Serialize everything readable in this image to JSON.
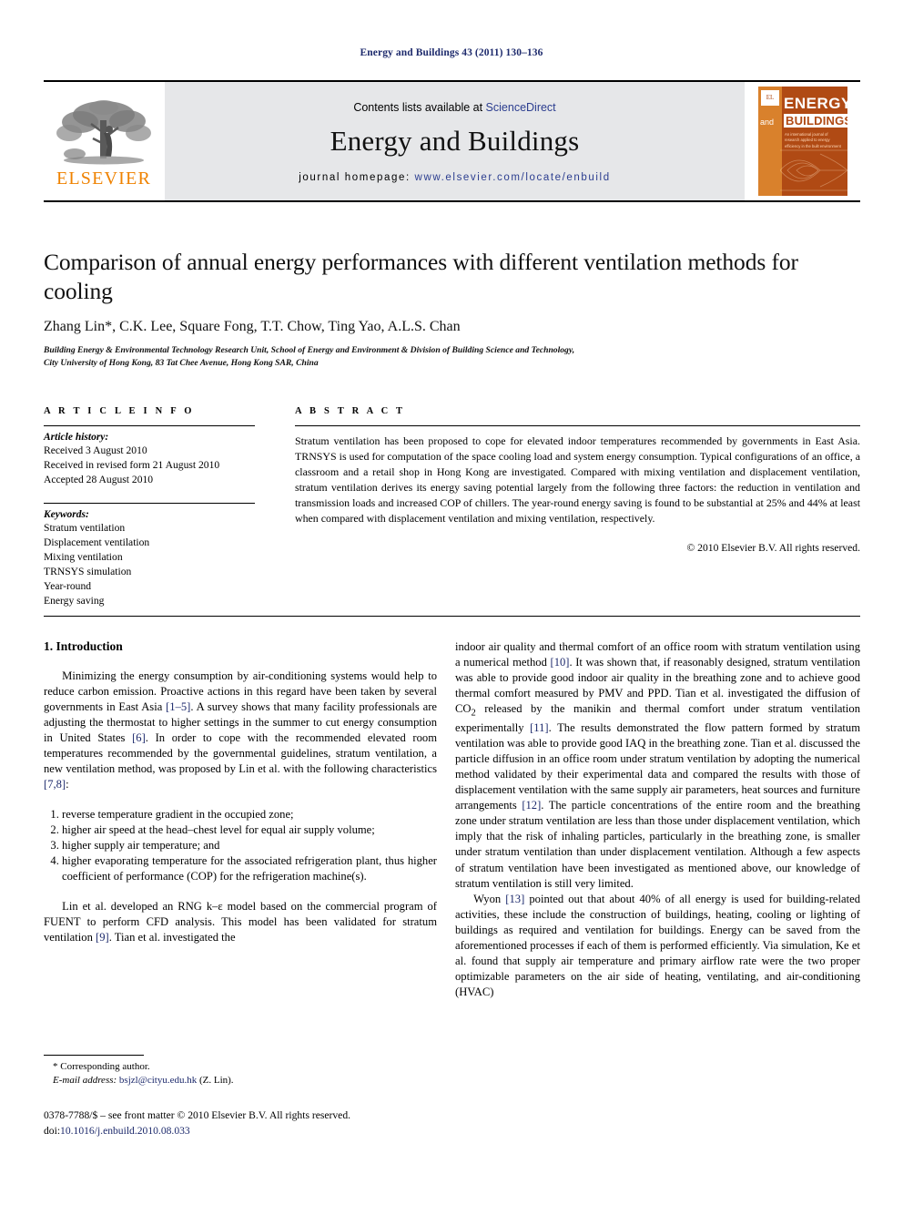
{
  "running_head": "Energy and Buildings 43 (2011) 130–136",
  "masthead": {
    "publisher_name": "ELSEVIER",
    "contents_prefix": "Contents lists available at ",
    "contents_link": "ScienceDirect",
    "journal_title": "Energy and Buildings",
    "homepage_prefix": "journal homepage: ",
    "homepage_url": "www.elsevier.com/locate/enbuild",
    "cover": {
      "line1": "ENERGY",
      "line2": "and",
      "line3": "BUILDINGS",
      "subtitle": "An international journal of research applied to energy efficiency in the built environment"
    }
  },
  "article": {
    "title": "Comparison of annual energy performances with different ventilation methods for cooling",
    "authors": "Zhang Lin*, C.K. Lee, Square Fong, T.T. Chow, Ting Yao, A.L.S. Chan",
    "affiliation_line1": "Building Energy & Environmental Technology Research Unit, School of Energy and Environment & Division of Building Science and Technology,",
    "affiliation_line2": "City University of Hong Kong, 83 Tat Chee Avenue, Hong Kong SAR, China"
  },
  "article_info": {
    "heading": "A R T I C L E    I N F O",
    "history_label": "Article history:",
    "history": [
      "Received 3 August 2010",
      "Received in revised form 21 August 2010",
      "Accepted 28 August 2010"
    ],
    "keywords_label": "Keywords:",
    "keywords": [
      "Stratum ventilation",
      "Displacement ventilation",
      "Mixing ventilation",
      "TRNSYS simulation",
      "Year-round",
      "Energy saving"
    ]
  },
  "abstract": {
    "heading": "A B S T R A C T",
    "text": "Stratum ventilation has been proposed to cope for elevated indoor temperatures recommended by governments in East Asia. TRNSYS is used for computation of the space cooling load and system energy consumption. Typical configurations of an office, a classroom and a retail shop in Hong Kong are investigated. Compared with mixing ventilation and displacement ventilation, stratum ventilation derives its energy saving potential largely from the following three factors: the reduction in ventilation and transmission loads and increased COP of chillers. The year-round energy saving is found to be substantial at 25% and 44% at least when compared with displacement ventilation and mixing ventilation, respectively.",
    "copyright": "© 2010 Elsevier B.V. All rights reserved."
  },
  "body": {
    "section_heading": "1.  Introduction",
    "left_para1_a": "Minimizing the energy consumption by air-conditioning systems would help to reduce carbon emission. Proactive actions in this regard have been taken by several governments in East Asia ",
    "left_para1_ref1": "[1–5]",
    "left_para1_b": ". A survey shows that many facility professionals are adjusting the thermostat to higher settings in the summer to cut energy consumption in United States ",
    "left_para1_ref2": "[6]",
    "left_para1_c": ". In order to cope with the recommended elevated room temperatures recommended by the governmental guidelines, stratum ventilation, a new ventilation method, was proposed by Lin et al. with the following characteristics ",
    "left_para1_ref3": "[7,8]",
    "left_para1_d": ":",
    "characteristics": [
      "reverse temperature gradient in the occupied zone;",
      "higher air speed at the head–chest level for equal air supply volume;",
      "higher supply air temperature; and",
      "higher evaporating temperature for the associated refrigeration plant, thus higher coefficient of performance (COP) for the refrigeration machine(s)."
    ],
    "left_para2_a": "Lin et al. developed an RNG k–ε model based on the commercial program of FUENT to perform CFD analysis. This model has been validated for stratum ventilation ",
    "left_para2_ref": "[9]",
    "left_para2_b": ". Tian et al. investigated the",
    "right_para1_a": "indoor air quality and thermal comfort of an office room with stratum ventilation using a numerical method ",
    "right_para1_ref1": "[10]",
    "right_para1_b": ". It was shown that, if reasonably designed, stratum ventilation was able to provide good indoor air quality in the breathing zone and to achieve good thermal comfort measured by PMV and PPD. Tian et al. investigated the diffusion of CO",
    "right_para1_sub": "2",
    "right_para1_c": " released by the manikin and thermal comfort under stratum ventilation experimentally ",
    "right_para1_ref2": "[11]",
    "right_para1_d": ". The results demonstrated the flow pattern formed by stratum ventilation was able to provide good IAQ in the breathing zone. Tian et al. discussed the particle diffusion in an office room under stratum ventilation by adopting the numerical method validated by their experimental data and compared the results with those of displacement ventilation with the same supply air parameters, heat sources and furniture arrangements ",
    "right_para1_ref3": "[12]",
    "right_para1_e": ". The particle concentrations of the entire room and the breathing zone under stratum ventilation are less than those under displacement ventilation, which imply that the risk of inhaling particles, particularly in the breathing zone, is smaller under stratum ventilation than under displacement ventilation. Although a few aspects of stratum ventilation have been investigated as mentioned above, our knowledge of stratum ventilation is still very limited.",
    "right_para2_a": "Wyon ",
    "right_para2_ref": "[13]",
    "right_para2_b": " pointed out that about 40% of all energy is used for building-related activities, these include the construction of buildings, heating, cooling or lighting of buildings as required and ventilation for buildings. Energy can be saved from the aforementioned processes if each of them is performed efficiently. Via simulation, Ke et al. found that supply air temperature and primary airflow rate were the two proper optimizable parameters on the air side of heating, ventilating, and air-conditioning (HVAC)"
  },
  "footer": {
    "corresponding": "* Corresponding author.",
    "email_label": "E-mail address:",
    "email": "bsjzl@cityu.edu.hk",
    "email_suffix": " (Z. Lin).",
    "issn_line": "0378-7788/$ – see front matter © 2010 Elsevier B.V. All rights reserved.",
    "doi_label": "doi:",
    "doi_value": "10.1016/j.enbuild.2010.08.033"
  }
}
